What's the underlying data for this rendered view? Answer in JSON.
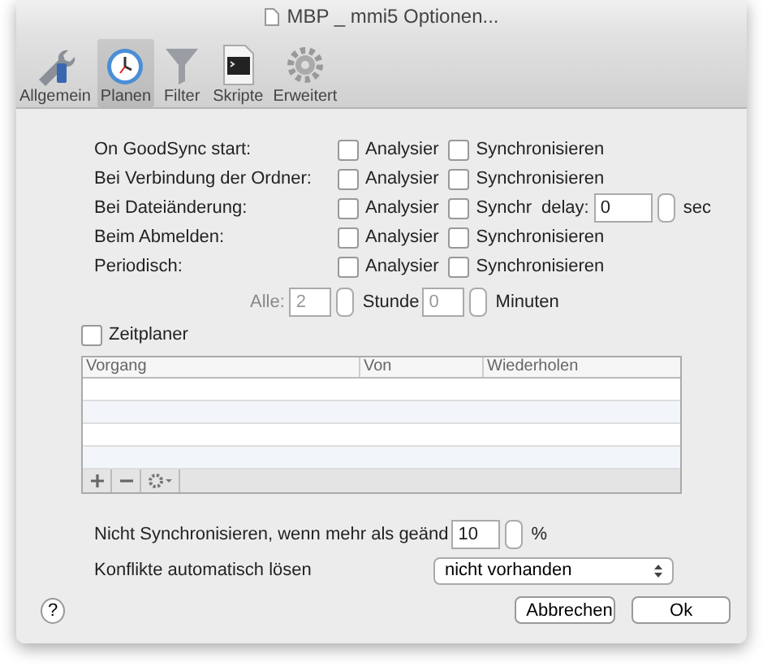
{
  "window": {
    "title": "MBP _ mmi5 Optionen..."
  },
  "toolbar": [
    {
      "label": "Allgemein",
      "selected": false
    },
    {
      "label": "Planen",
      "selected": true
    },
    {
      "label": "Filter",
      "selected": false
    },
    {
      "label": "Skripte",
      "selected": false
    },
    {
      "label": "Erweitert",
      "selected": false
    }
  ],
  "triggers": [
    {
      "label": "On GoodSync start:",
      "analyze": {
        "label": "Analysier",
        "checked": false
      },
      "sync": {
        "label": "Synchronisieren",
        "checked": false
      }
    },
    {
      "label": "Bei Verbindung der Ordner:",
      "analyze": {
        "label": "Analysier",
        "checked": false
      },
      "sync": {
        "label": "Synchronisieren",
        "checked": false
      }
    },
    {
      "label": "Bei Dateiänderung:",
      "analyze": {
        "label": "Analysier",
        "checked": false
      },
      "sync": {
        "label": "Synchr",
        "checked": false
      },
      "delay": {
        "label": "delay:",
        "value": "0",
        "unit": "sec"
      }
    },
    {
      "label": "Beim Abmelden:",
      "analyze": {
        "label": "Analysier",
        "checked": false
      },
      "sync": {
        "label": "Synchronisieren",
        "checked": false
      }
    },
    {
      "label": "Periodisch:",
      "analyze": {
        "label": "Analysier",
        "checked": false
      },
      "sync": {
        "label": "Synchronisieren",
        "checked": false
      }
    }
  ],
  "interval": {
    "label": "Alle:",
    "hours": "2",
    "hours_unit": "Stunde",
    "minutes": "0",
    "minutes_unit": "Minuten",
    "disabled": true
  },
  "scheduler": {
    "label": "Zeitplaner",
    "checked": false,
    "columns": [
      "Vorgang",
      "Von",
      "Wiederholen"
    ]
  },
  "threshold": {
    "label": "Nicht Synchronisieren, wenn mehr als geänd",
    "value": "10",
    "unit": "%"
  },
  "conflicts": {
    "label": "Konflikte automatisch lösen",
    "value": "nicht vorhanden"
  },
  "help": "?",
  "buttons": [
    {
      "label": "Abbrechen"
    },
    {
      "label": "Ok"
    }
  ]
}
